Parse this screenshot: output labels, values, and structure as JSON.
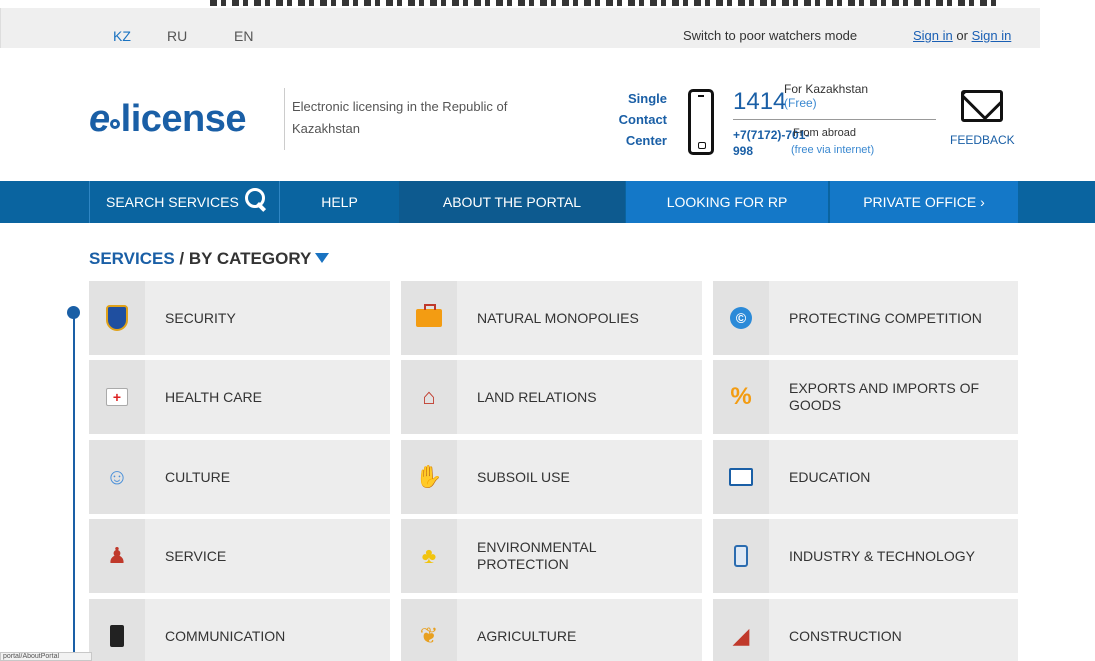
{
  "languages": [
    {
      "label": "KZ",
      "active": true
    },
    {
      "label": "RU",
      "active": false
    },
    {
      "label": "EN",
      "active": false
    }
  ],
  "topbar": {
    "poor_watchers_mode": "Switch to poor watchers mode",
    "sign_in_1": "Sign in",
    "or": "or",
    "sign_in_2": "Sign in"
  },
  "header": {
    "logo_e": "e",
    "logo_rest": "license",
    "tagline": "Electronic licensing in the Republic of Kazakhstan",
    "scc_line1": "Single",
    "scc_line2": "Contact",
    "scc_line3": "Center",
    "phone_short": "1414",
    "for_kazakhstan": "For Kazakhstan",
    "free": "(Free)",
    "abroad_number": "+7(7172)-701-998",
    "from_abroad": "From abroad",
    "free_via_internet": "(free via internet)",
    "feedback": "FEEDBACK"
  },
  "nav": {
    "search": "SEARCH SERVICES",
    "help": "HELP",
    "about": "ABOUT THE PORTAL",
    "looking": "LOOKING FOR RP",
    "private": "PRIVATE OFFICE ›"
  },
  "services": {
    "title": "SERVICES",
    "subtitle": "/ BY CATEGORY",
    "categories": [
      {
        "label": "SECURITY",
        "icon": "shield-icon"
      },
      {
        "label": "NATURAL MONOPOLIES",
        "icon": "briefcase-icon"
      },
      {
        "label": "PROTECTING COMPETITION",
        "icon": "copyright-icon"
      },
      {
        "label": "HEALTH CARE",
        "icon": "first-aid-icon"
      },
      {
        "label": "LAND RELATIONS",
        "icon": "house-icon"
      },
      {
        "label": "EXPORTS AND IMPORTS OF GOODS",
        "icon": "percent-icon"
      },
      {
        "label": "CULTURE",
        "icon": "theater-masks-icon"
      },
      {
        "label": "SUBSOIL USE",
        "icon": "handshake-icon"
      },
      {
        "label": "EDUCATION",
        "icon": "book-icon"
      },
      {
        "label": "SERVICE",
        "icon": "people-icon"
      },
      {
        "label": "ENVIRONMENTAL PROTECTION",
        "icon": "tree-icon"
      },
      {
        "label": "INDUSTRY & TECHNOLOGY",
        "icon": "tool-icon"
      },
      {
        "label": "COMMUNICATION",
        "icon": "walkie-talkie-icon"
      },
      {
        "label": "AGRICULTURE",
        "icon": "wheat-icon"
      },
      {
        "label": "CONSTRUCTION",
        "icon": "trowel-icon"
      }
    ]
  },
  "statusbar": {
    "text": "portal/AboutPortal"
  }
}
